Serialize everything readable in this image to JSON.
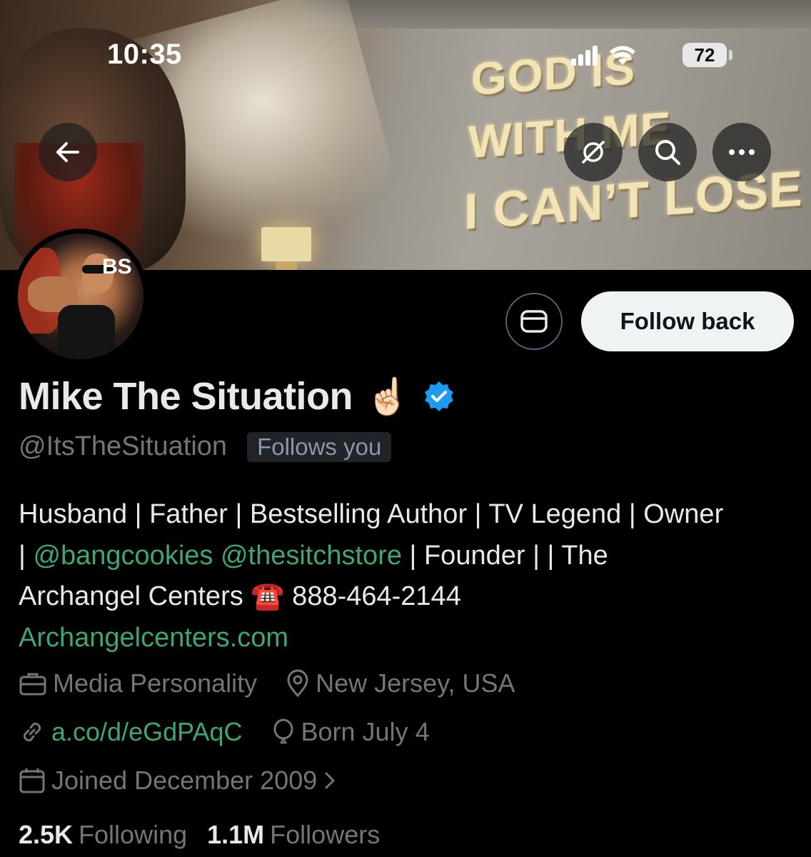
{
  "status_bar": {
    "time": "10:35",
    "battery": "72"
  },
  "banner": {
    "neon_line1": "GOD IS",
    "neon_line2": "WITH ME",
    "neon_line3": "I CAN’T LOSE",
    "avatar_logo": "BS"
  },
  "header_buttons": {
    "back_icon": "arrow-left-icon",
    "grok_icon": "grok-icon",
    "search_icon": "search-icon",
    "more_icon": "more-icon"
  },
  "actions": {
    "message_icon": "message-icon",
    "follow_label": "Follow back"
  },
  "profile": {
    "display_name": "Mike The Situation",
    "name_emoji": "☝🏻",
    "verified": true,
    "handle": "@ItsTheSituation",
    "follows_you_label": "Follows you"
  },
  "bio": {
    "line1": "Husband | Father | Bestselling Author | TV Legend | Owner",
    "sep1": "| ",
    "mention1": "@bangcookies",
    "mention2": "@thesitchstore",
    "line2_rest": " | Founder | | The",
    "line3": "Archangel Centers ",
    "phone_emoji": "☎️",
    "phone": " 888-464-2144",
    "website": "Archangelcenters.com"
  },
  "meta": {
    "category": "Media Personality",
    "location": "New Jersey, USA",
    "link": "a.co/d/eGdPAqC",
    "birthday": "Born July 4",
    "joined": "Joined December 2009"
  },
  "stats": {
    "following_count": "2.5K",
    "following_label": "Following",
    "followers_count": "1.1M",
    "followers_label": "Followers"
  },
  "colors": {
    "background": "#000000",
    "link_green": "#3fa672",
    "muted": "#71767b",
    "verified_blue": "#1d9bf0"
  }
}
